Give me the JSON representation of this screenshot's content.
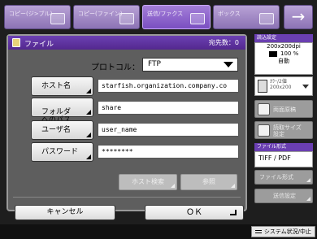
{
  "top_tabs": [
    {
      "label": "コピー(ジ>ブル)",
      "icon": "copy-icon"
    },
    {
      "label": "コピー(ファイン)",
      "icon": "copy-icon"
    },
    {
      "label": "送信/ファクス",
      "icon": "send-icon"
    },
    {
      "label": "ボックス",
      "icon": "box-icon"
    }
  ],
  "next_symbol": "→",
  "dialog": {
    "title": "ファイル",
    "dest_count": "宛先数：0",
    "protocol_label": "プロトコル：",
    "protocol_value": "FTP",
    "fields": [
      {
        "button": "ホスト名",
        "value": "starfish.organization.company.co"
      },
      {
        "button": "フォルダ\nへのパス",
        "value": "share"
      },
      {
        "button": "ユーザ名",
        "value": "user_name"
      },
      {
        "button": "パスワード",
        "value": "********"
      }
    ],
    "host_search": "ホスト検索",
    "browse": "参照",
    "cancel": "キャンセル",
    "ok": "ＯＫ"
  },
  "settings": {
    "header": "読込設定",
    "resolution": "200x200dpi",
    "color_mode": "100 %",
    "auto": "自動",
    "density_line1": "ｶﾗｰ/2値",
    "density_line2": "200x200",
    "double_side": "両面原稿",
    "original_size": "読取サイズ\n設定",
    "file_format_header": "ファイル形式",
    "file_format_value": "TIFF / PDF",
    "file_format_button": "ファイル形式",
    "send_settings": "送信設定"
  },
  "status": {
    "system_status": "システム状況/中止"
  },
  "colors": {
    "accent": "#6a3fb1",
    "tab": "#9a82c2",
    "background": "#1e1e1e"
  }
}
